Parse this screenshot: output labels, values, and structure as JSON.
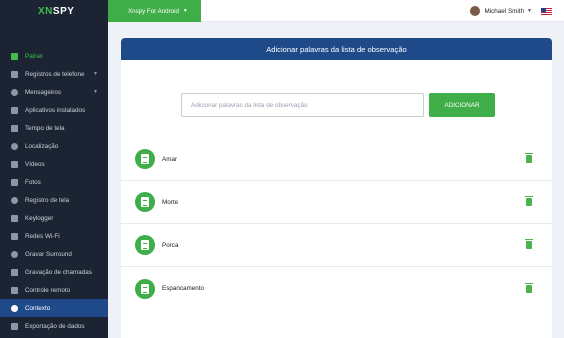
{
  "logo": {
    "prefix": "XN",
    "suffix": "SPY"
  },
  "sidebar": {
    "items": [
      {
        "label": "Painel",
        "icon": "dashboard-icon",
        "expandable": false
      },
      {
        "label": "Registros de telefone",
        "icon": "phone-icon",
        "expandable": true
      },
      {
        "label": "Mensageiros",
        "icon": "chat-icon",
        "expandable": true
      },
      {
        "label": "Aplicativos instalados",
        "icon": "apps-icon",
        "expandable": false
      },
      {
        "label": "Tempo de tela",
        "icon": "clock-icon",
        "expandable": false
      },
      {
        "label": "Localização",
        "icon": "location-icon",
        "expandable": false
      },
      {
        "label": "Vídeos",
        "icon": "video-icon",
        "expandable": false
      },
      {
        "label": "Fotos",
        "icon": "photo-icon",
        "expandable": false
      },
      {
        "label": "Registro de tela",
        "icon": "screen-record-icon",
        "expandable": false
      },
      {
        "label": "Keylogger",
        "icon": "keyboard-icon",
        "expandable": false
      },
      {
        "label": "Redes Wi-Fi",
        "icon": "wifi-icon",
        "expandable": false
      },
      {
        "label": "Gravar Surround",
        "icon": "microphone-icon",
        "expandable": false
      },
      {
        "label": "Gravação de chamadas",
        "icon": "call-record-icon",
        "expandable": false
      },
      {
        "label": "Controle remoto",
        "icon": "remote-icon",
        "expandable": false
      },
      {
        "label": "Contexto",
        "icon": "gear-icon",
        "expandable": false
      },
      {
        "label": "Exportação de dados",
        "icon": "export-icon",
        "expandable": false
      }
    ],
    "active_index": 14
  },
  "topbar": {
    "device_label": "Xnspy For Android",
    "user_name": "Michael Smith"
  },
  "panel": {
    "title": "Adicionar palavras da lista de observação",
    "search_placeholder": "Adicionar palavras da lista de observação",
    "search_value": "",
    "add_button": "ADICIONAR"
  },
  "words": [
    "Amar",
    "Morte",
    "Porca",
    "Espancamento"
  ],
  "colors": {
    "sidebar_bg": "#1c2434",
    "accent_green": "#3fae48",
    "header_blue": "#1f4a8a"
  }
}
